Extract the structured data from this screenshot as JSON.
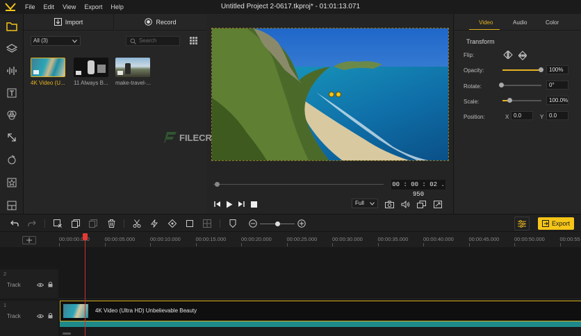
{
  "window": {
    "title": "Untitled Project 2-0617.tkproj* - 01:01:13.071"
  },
  "menu": [
    "File",
    "Edit",
    "View",
    "Export",
    "Help"
  ],
  "sidebar": [
    {
      "icon": "folder-icon"
    },
    {
      "icon": "layers-icon"
    },
    {
      "icon": "audio-wave-icon"
    },
    {
      "icon": "text-icon"
    },
    {
      "icon": "effects-icon"
    },
    {
      "icon": "transition-icon"
    },
    {
      "icon": "filter-icon"
    },
    {
      "icon": "sticker-icon"
    },
    {
      "icon": "layout-icon"
    }
  ],
  "media": {
    "import_label": "Import",
    "record_label": "Record",
    "filter_value": "All (3)",
    "search_placeholder": "Search",
    "items": [
      {
        "label": "4K Video (U..."
      },
      {
        "label": "11 Always B..."
      },
      {
        "label": "make-travel-..."
      }
    ]
  },
  "preview": {
    "timecode": "00 : 00 : 02 . 950",
    "quality": "Full",
    "progress": 0.0
  },
  "props": {
    "tabs": [
      "Video",
      "Audio",
      "Color"
    ],
    "active_tab": "Video",
    "section": "Transform",
    "flip_label": "Flip:",
    "opacity_label": "Opacity:",
    "opacity_value": "100%",
    "opacity_level": 1.0,
    "rotate_label": "Rotate:",
    "rotate_value": "0°",
    "scale_label": "Scale:",
    "scale_value": "100.0%",
    "scale_level": 0.2,
    "position_label": "Position:",
    "x_label": "X",
    "x_value": "0.0",
    "y_label": "Y",
    "y_value": "0.0"
  },
  "toolbar": {
    "export_label": "Export"
  },
  "timeline": {
    "ticks": [
      "00:00:00.000",
      "00:00:05.000",
      "00:00:10.000",
      "00:00:15.000",
      "00:00:20.000",
      "00:00:25.000",
      "00:00:30.000",
      "00:00:35.000",
      "00:00:40.000",
      "00:00:45.000",
      "00:00:50.000",
      "00:00:55"
    ],
    "tracks": [
      {
        "number": "2",
        "name": "Track"
      },
      {
        "number": "1",
        "name": "Track"
      }
    ],
    "clip_label": "4K Video (Ultra HD) Unbelievable Beauty"
  },
  "watermark": "FILECR",
  "colors": {
    "accent": "#f5c518",
    "playhead": "#e53935",
    "background": "#1e1e1e"
  }
}
